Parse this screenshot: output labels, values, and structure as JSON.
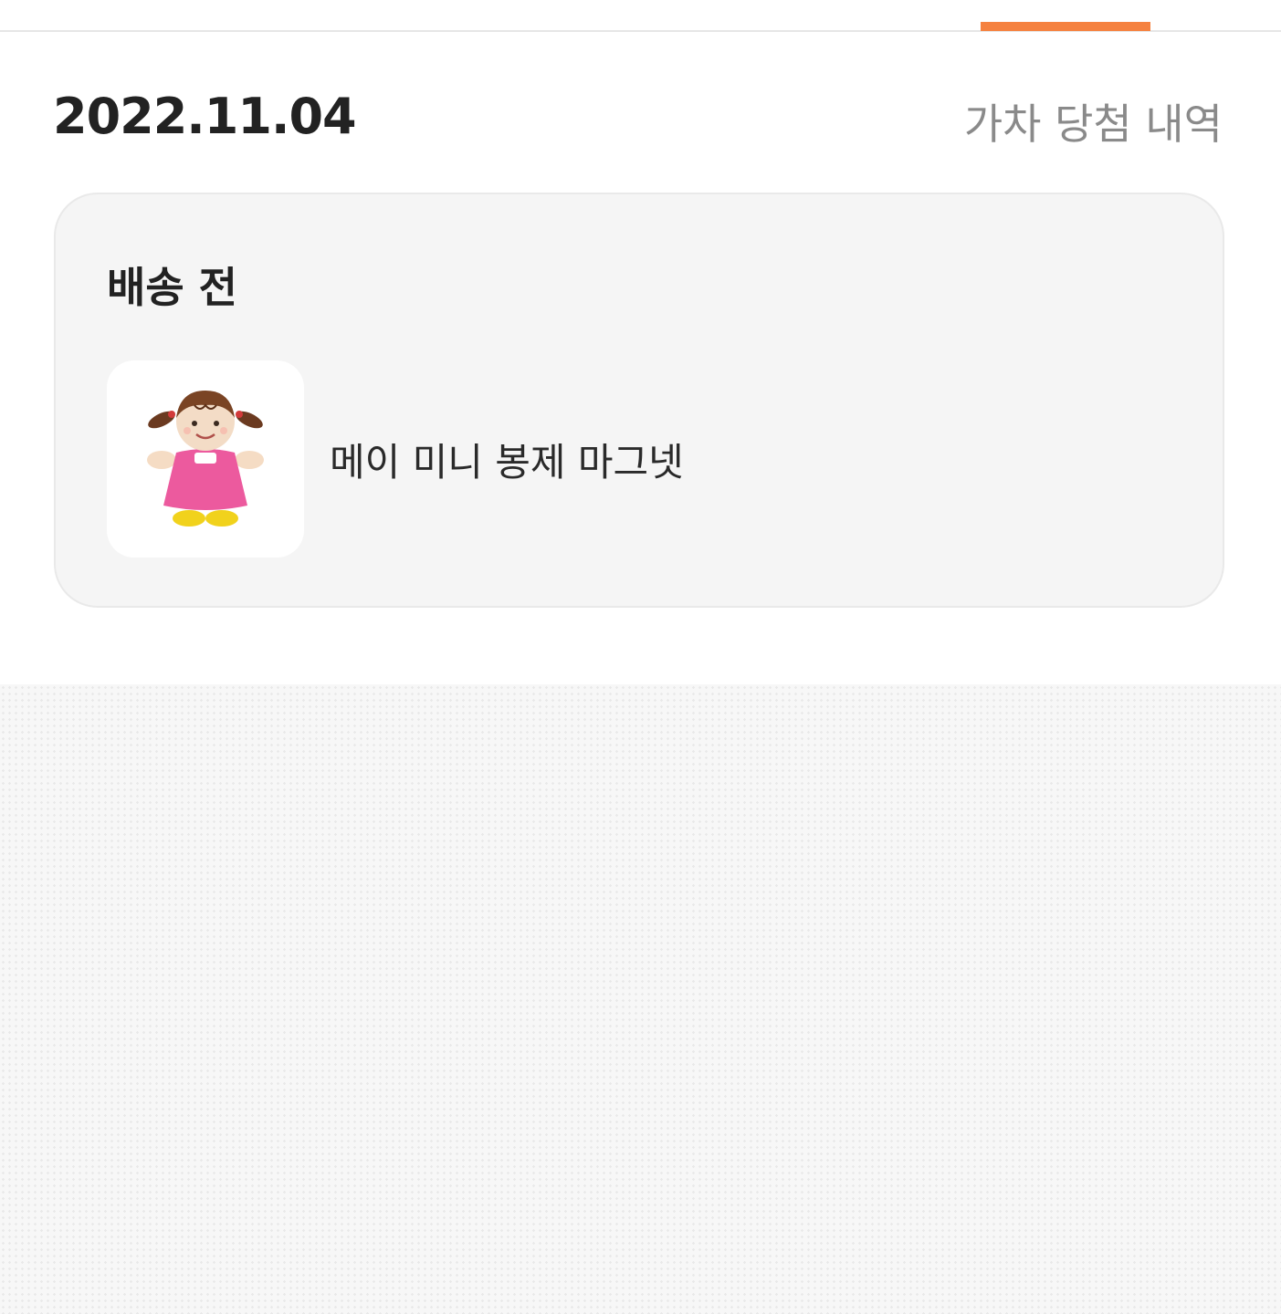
{
  "date": "2022.11.04",
  "history_link": "가차 당첨 내역",
  "group": {
    "status": "배송 전",
    "items": [
      {
        "name": "메이 미니 봉제 마그넷",
        "thumbnail_icon": "doll-plush-icon"
      }
    ]
  },
  "colors": {
    "tab_indicator": "#f5813f",
    "card_background": "#f5f5f5"
  }
}
